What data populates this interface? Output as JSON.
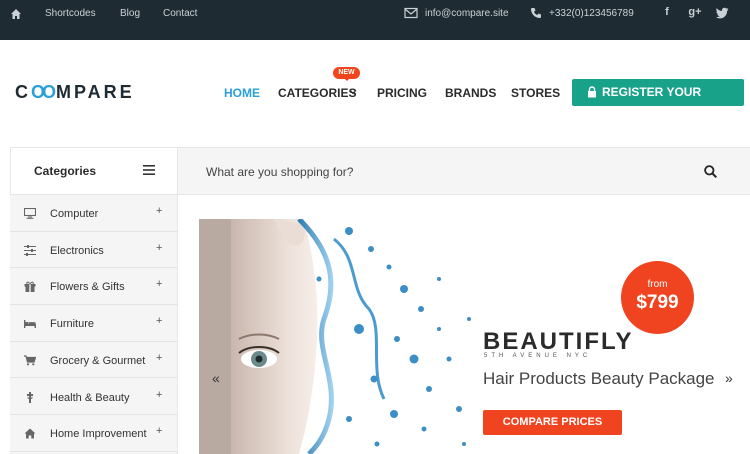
{
  "topbar": {
    "links": [
      "Shortcodes",
      "Blog",
      "Contact"
    ],
    "email": "info@compare.site",
    "phone": "+332(0)123456789",
    "social": [
      "f",
      "g+",
      "t"
    ]
  },
  "header": {
    "logo_c": "C",
    "logo_oo": "OO",
    "logo_rest": "MPARE",
    "nav": [
      "HOME",
      "CATEGORIES",
      "PRICING",
      "BRANDS",
      "STORES"
    ],
    "new_badge": "NEW",
    "register_label": "REGISTER YOUR STORE"
  },
  "sidebar": {
    "title": "Categories",
    "items": [
      {
        "label": "Computer",
        "icon": "monitor-icon"
      },
      {
        "label": "Electronics",
        "icon": "sliders-icon"
      },
      {
        "label": "Flowers & Gifts",
        "icon": "gift-icon"
      },
      {
        "label": "Furniture",
        "icon": "bed-icon"
      },
      {
        "label": "Grocery & Gourmet",
        "icon": "cart-icon"
      },
      {
        "label": "Health & Beauty",
        "icon": "health-icon"
      },
      {
        "label": "Home Improvement",
        "icon": "home-icon"
      }
    ],
    "plus": "+"
  },
  "search": {
    "placeholder": "What are you shopping for?"
  },
  "banner": {
    "from": "from",
    "price": "$799",
    "brand": "BEAUTIFLY",
    "brand_sub": "5TH AVENUE NYC",
    "title": "Hair Products Beauty Package",
    "button": "COMPARE PRICES",
    "prev": "«",
    "next": "»"
  },
  "colors": {
    "topbar": "#1e2b33",
    "accent_blue": "#2a9fd8",
    "register_green": "#19a28a",
    "orange": "#f0431f"
  }
}
